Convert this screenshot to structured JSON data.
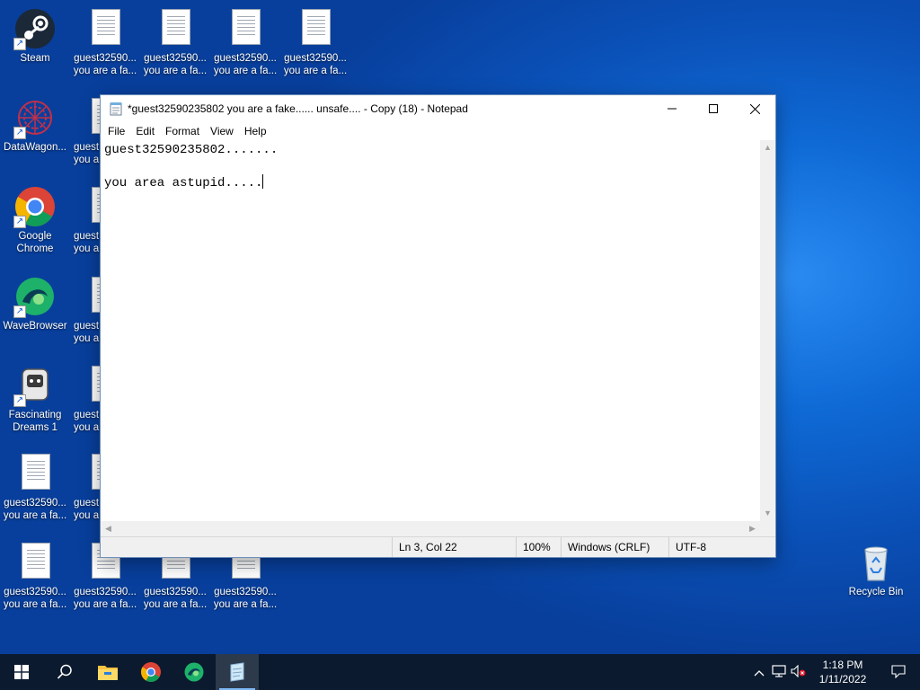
{
  "desktop": {
    "icons_top_row": [
      {
        "label1": "Steam",
        "label2": ""
      },
      {
        "label1": "guest32590...",
        "label2": "you are a fa..."
      },
      {
        "label1": "guest32590...",
        "label2": "you are a fa..."
      },
      {
        "label1": "guest32590...",
        "label2": "you are a fa..."
      },
      {
        "label1": "guest32590...",
        "label2": "you are a fa..."
      }
    ],
    "left_column": [
      {
        "label1": "DataWagon...",
        "label2": ""
      },
      {
        "label1": "Google",
        "label2": "Chrome"
      },
      {
        "label1": "WaveBrowser",
        "label2": ""
      },
      {
        "label1": "Fascinating",
        "label2": "Dreams 1"
      },
      {
        "label1": "guest32590...",
        "label2": "you are a fa..."
      },
      {
        "label1": "guest32590...",
        "label2": "you are a fa..."
      }
    ],
    "partial_column_labels": [
      {
        "label1": "guest",
        "label2": "you a"
      },
      {
        "label1": "guest",
        "label2": "you a"
      },
      {
        "label1": "guest",
        "label2": "you a"
      },
      {
        "label1": "guest",
        "label2": "you a"
      },
      {
        "label1": "guest",
        "label2": "you a"
      }
    ],
    "bottom_row": [
      {
        "label1": "guest32590...",
        "label2": "you are a fa..."
      },
      {
        "label1": "guest32590...",
        "label2": "you are a fa..."
      },
      {
        "label1": "guest32590...",
        "label2": "you are a fa..."
      }
    ],
    "recycle_bin": {
      "label": "Recycle Bin"
    }
  },
  "notepad": {
    "title": "*guest32590235802 you are a fake...... unsafe.... - Copy (18) - Notepad",
    "menu": [
      "File",
      "Edit",
      "Format",
      "View",
      "Help"
    ],
    "content_line1": "guest32590235802.......",
    "content_line2": "",
    "content_line3": "you area astupid.....",
    "status": {
      "position": "Ln 3, Col 22",
      "zoom": "100%",
      "line_ending": "Windows (CRLF)",
      "encoding": "UTF-8"
    }
  },
  "taskbar": {
    "time": "1:18 PM",
    "date": "1/11/2022"
  },
  "colors": {
    "desktop_blue": "#0a56c4",
    "taskbar_bg": "#0b1a2e",
    "window_border": "#6d8fb8"
  }
}
